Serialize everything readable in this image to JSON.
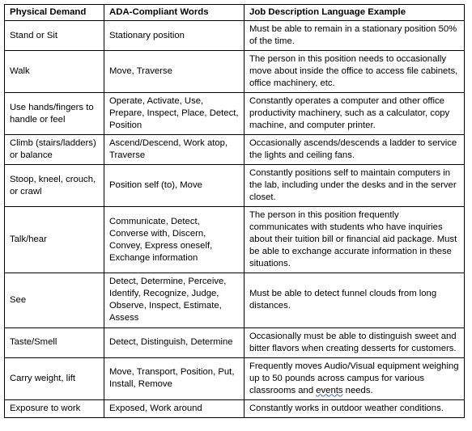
{
  "table": {
    "headers": [
      "Physical  Demand",
      "ADA-Compliant  Words",
      "Job Description Language Example"
    ],
    "rows": [
      {
        "demand": "Stand or Sit",
        "words": "Stationary position",
        "example_pre": "Must be able to remain in a stationary position 50% of the time.",
        "example_marked": "",
        "example_post": ""
      },
      {
        "demand": "Walk",
        "words": "Move, Traverse",
        "example_pre": "The person in this position needs to occasionally move about inside the office to access file cabinets, office machinery, etc.",
        "example_marked": "",
        "example_post": ""
      },
      {
        "demand": "Use hands/fingers to handle or feel",
        "words": "Operate, Activate, Use, Prepare, Inspect, Place, Detect, Position",
        "example_pre": "Constantly operates a computer and other office productivity machinery, such as a calculator, copy machine, and computer printer.",
        "example_marked": "",
        "example_post": ""
      },
      {
        "demand": "Climb (stairs/ladders) or balance",
        "words": "Ascend/Descend, Work atop, Traverse",
        "example_pre": "Occasionally ascends/descends a ladder to service the lights and ceiling fans.",
        "example_marked": "",
        "example_post": ""
      },
      {
        "demand": "Stoop, kneel, crouch, or crawl",
        "words": "Position self (to), Move",
        "example_pre": "Constantly positions self to maintain computers in the lab, including under the desks and in the server closet.",
        "example_marked": "",
        "example_post": ""
      },
      {
        "demand": "Talk/hear",
        "words": "Communicate, Detect, Converse with, Discern, Convey, Express oneself, Exchange information",
        "example_pre": "The person in this position frequently communicates with students who have inquiries about their tuition bill or financial aid package.  Must be able to exchange accurate information in these situations.",
        "example_marked": "",
        "example_post": ""
      },
      {
        "demand": "See",
        "words": "Detect, Determine, Perceive, Identify, Recognize, Judge, Observe, Inspect, Estimate, Assess",
        "example_pre": "Must be able to detect funnel clouds from long distances.",
        "example_marked": "",
        "example_post": ""
      },
      {
        "demand": "Taste/Smell",
        "words": "Detect, Distinguish, Determine",
        "example_pre": "Occasionally must be able to distinguish sweet and bitter flavors when creating desserts for customers.",
        "example_marked": "",
        "example_post": ""
      },
      {
        "demand": "Carry weight, lift",
        "words": "Move, Transport, Position, Put, Install, Remove",
        "example_pre": "Frequently moves Audio/Visual equipment weighing up to 50 pounds across campus for various classrooms and ",
        "example_marked": "events",
        "example_post": " needs."
      },
      {
        "demand": "Exposure to work",
        "words": "Exposed, Work around",
        "example_pre": "Constantly works in outdoor weather conditions.",
        "example_marked": "",
        "example_post": ""
      }
    ]
  },
  "colors": {
    "border": "#000000",
    "text": "#000000",
    "background": "#ffffff",
    "spellcheck_underline": "#4a6fb5"
  }
}
